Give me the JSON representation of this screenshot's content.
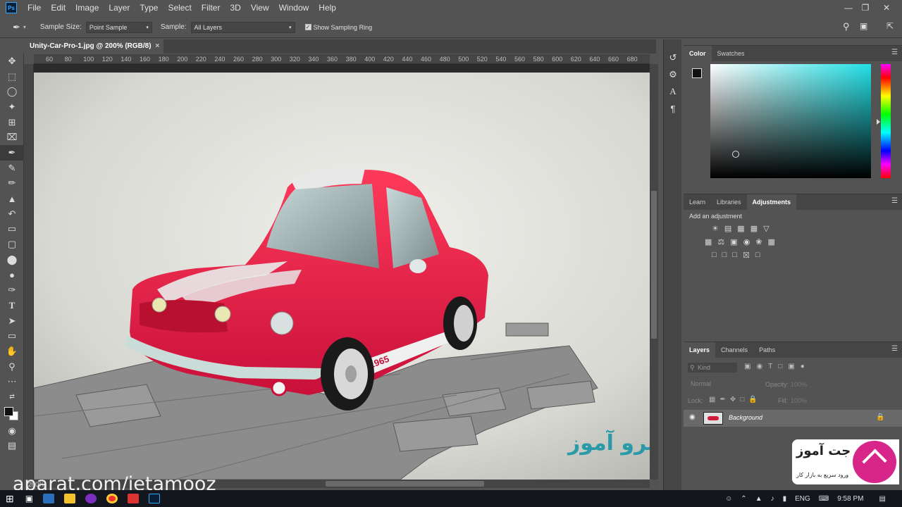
{
  "menubar": {
    "app_logo": "Ps",
    "items": [
      "File",
      "Edit",
      "Image",
      "Layer",
      "Type",
      "Select",
      "Filter",
      "3D",
      "View",
      "Window",
      "Help"
    ]
  },
  "options": {
    "sample_size_label": "Sample Size:",
    "sample_size_value": "Point Sample",
    "sample_label": "Sample:",
    "sample_value": "All Layers",
    "ring_label": "Show Sampling Ring",
    "ring_checked": true
  },
  "document": {
    "tab_title": "Unity-Car-Pro-1.jpg @ 200% (RGB/8)",
    "ruler_ticks": [
      "60",
      "80",
      "100",
      "120",
      "140",
      "160",
      "180",
      "200",
      "220",
      "240",
      "260",
      "280",
      "300",
      "320",
      "340",
      "360",
      "380",
      "400",
      "420",
      "440",
      "460",
      "480",
      "500",
      "520",
      "540",
      "560",
      "580",
      "600",
      "620",
      "640",
      "660",
      "680"
    ],
    "car_plate": "1965",
    "watermark_text": "سرو آموز"
  },
  "color_panel": {
    "tabs": [
      "Color",
      "Swatches"
    ],
    "active_tab": "Color",
    "hue_color": "#22e0e6"
  },
  "adjustments_panel": {
    "tabs": [
      "Learn",
      "Libraries",
      "Adjustments"
    ],
    "active_tab": "Adjustments",
    "subtitle": "Add an adjustment"
  },
  "layers_panel": {
    "tabs": [
      "Layers",
      "Channels",
      "Paths"
    ],
    "active_tab": "Layers",
    "filter_placeholder": "Kind",
    "blend_mode": "Normal",
    "opacity_label": "Opacity:",
    "opacity_value": "100%",
    "lock_label": "Lock:",
    "fill_label": "Fill:",
    "fill_value": "100%",
    "layers": [
      {
        "name": "Background"
      }
    ]
  },
  "logo": {
    "title": "جت آموز",
    "subtitle": "ورود سریع به بازار کار"
  },
  "overlay": {
    "aparat_text": "aparat.com/jetamooz",
    "status_zoom": "200%"
  },
  "taskbar": {
    "language": "ENG",
    "time": "9:58 PM"
  }
}
